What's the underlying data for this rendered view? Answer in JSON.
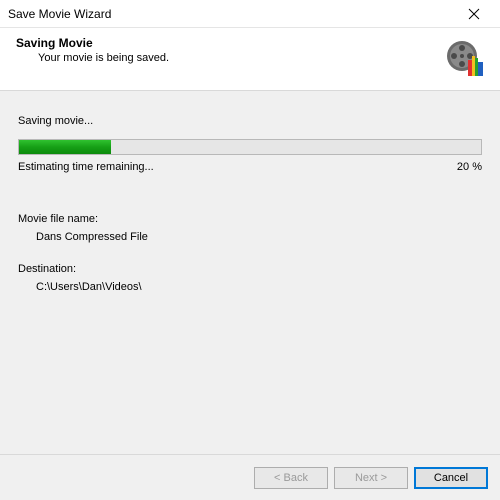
{
  "window": {
    "title": "Save Movie Wizard"
  },
  "header": {
    "title": "Saving Movie",
    "subtitle": "Your movie is being saved."
  },
  "progress": {
    "status": "Saving movie...",
    "eta_label": "Estimating time remaining...",
    "percent_label": "20 %",
    "percent_value": 20
  },
  "file": {
    "name_label": "Movie file name:",
    "name_value": "Dans Compressed File",
    "dest_label": "Destination:",
    "dest_value": "C:\\Users\\Dan\\Videos\\"
  },
  "buttons": {
    "back": "< Back",
    "next": "Next >",
    "cancel": "Cancel"
  },
  "colors": {
    "progress_green": "#16a016",
    "focus_blue": "#0078d7"
  }
}
